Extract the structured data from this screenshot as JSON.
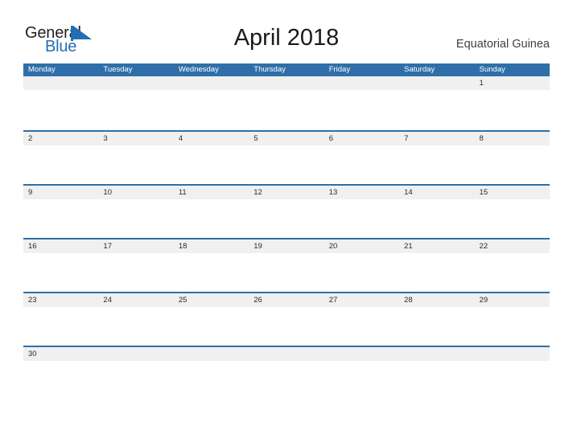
{
  "brand": {
    "name_part1": "General",
    "name_part2": "Blue",
    "flag_icon": "blue-flag-triangle-icon",
    "color_primary": "#1f6fb5",
    "color_text": "#231f20"
  },
  "header": {
    "title": "April 2018",
    "locale": "Equatorial Guinea"
  },
  "calendar": {
    "header_color": "#2f6fa9",
    "band_color": "#f0f0f0",
    "weekdays": [
      "Monday",
      "Tuesday",
      "Wednesday",
      "Thursday",
      "Friday",
      "Saturday",
      "Sunday"
    ],
    "weeks": [
      [
        "",
        "",
        "",
        "",
        "",
        "",
        "1"
      ],
      [
        "2",
        "3",
        "4",
        "5",
        "6",
        "7",
        "8"
      ],
      [
        "9",
        "10",
        "11",
        "12",
        "13",
        "14",
        "15"
      ],
      [
        "16",
        "17",
        "18",
        "19",
        "20",
        "21",
        "22"
      ],
      [
        "23",
        "24",
        "25",
        "26",
        "27",
        "28",
        "29"
      ],
      [
        "30",
        "",
        "",
        "",
        "",
        "",
        ""
      ]
    ]
  }
}
